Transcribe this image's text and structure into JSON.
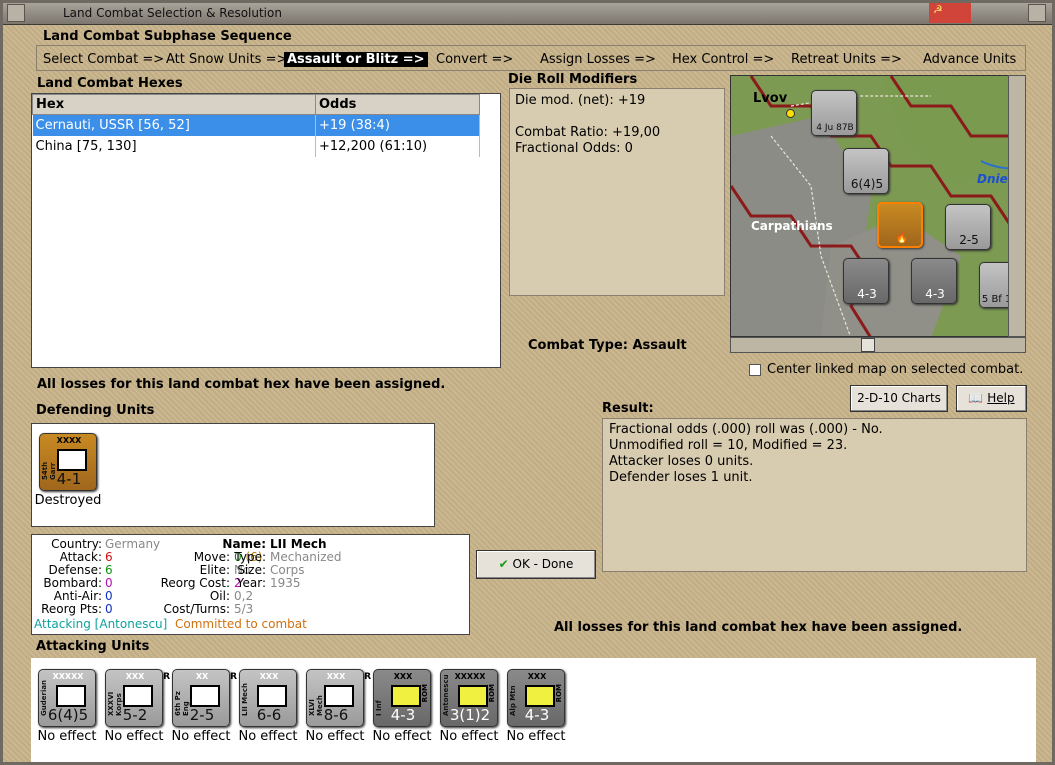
{
  "window": {
    "title": "Land Combat Selection & Resolution"
  },
  "subphase": {
    "heading": "Land Combat Subphase Sequence",
    "steps": [
      "Select Combat =>",
      "Att Snow Units =>",
      "Assault or Blitz =>",
      "Convert =>",
      "Assign Losses =>",
      "Hex Control =>",
      "Retreat Units =>",
      "Advance Units"
    ],
    "active_index": 2
  },
  "hexes": {
    "heading": "Land Combat Hexes",
    "columns": [
      "Hex",
      "Odds"
    ],
    "rows": [
      {
        "hex": "Cernauti, USSR [56, 52]",
        "odds": "+19 (38:4)"
      },
      {
        "hex": "China [75, 130]",
        "odds": "+12,200 (61:10)"
      }
    ],
    "selected_index": 0
  },
  "die_roll": {
    "heading": "Die Roll Modifiers",
    "net": "Die mod. (net): +19",
    "ratio": "Combat Ratio: +19,00",
    "fractional": "Fractional Odds: 0"
  },
  "combat_type": {
    "label": "Combat Type:",
    "value": "Assault"
  },
  "map": {
    "labels": {
      "city": "Lvov",
      "region": "Carpathians",
      "river": "Dnies"
    },
    "center_checkbox": {
      "label": "Center linked map on selected combat.",
      "checked": false
    }
  },
  "losses_msg": "All losses for this land combat hex have been assigned.",
  "defending": {
    "heading": "Defending Units",
    "units": [
      {
        "name": "54th Garr",
        "size": "XXXX",
        "value": "4-1",
        "status": "Destroyed",
        "color": "#b07822"
      }
    ]
  },
  "buttons": {
    "charts": "2-D-10 Charts",
    "help": "Help",
    "ok": "OK - Done"
  },
  "result": {
    "heading": "Result:",
    "lines": [
      "Fractional odds (.000) roll was (.000)  - No.",
      "Unmodified roll = 10, Modified = 23.",
      "Attacker loses 0 units.",
      "Defender loses 1 unit."
    ]
  },
  "unit_info": {
    "country_label": "Country:",
    "country": "Germany",
    "attack_label": "Attack:",
    "attack": "6",
    "defense_label": "Defense:",
    "defense": "6",
    "bombard_label": "Bombard:",
    "bombard": "0",
    "antiair_label": "Anti-Air:",
    "antiair": "0",
    "reorg_pts_label": "Reorg Pts:",
    "reorg_pts": "0",
    "name_label": "Name:",
    "name": "LII Mech",
    "move_label": "Move:",
    "move": "0",
    "move_paren": "(6)",
    "elite_label": "Elite:",
    "elite": "No",
    "reorg_cost_label": "Reorg Cost:",
    "reorg_cost": "2",
    "oil_label": "Oil:",
    "oil": "0,2",
    "cost_label": "Cost/Turns:",
    "cost": "5/3",
    "type_label": "Type:",
    "type": "Mechanized",
    "size_label": "Size:",
    "size": "Corps",
    "year_label": "Year:",
    "year": "1935",
    "attacking": "Attacking [Antonescu]",
    "committed": "Committed to combat"
  },
  "losses_msg2": "All losses for this land combat hex have been assigned.",
  "attacking": {
    "heading": "Attacking Units",
    "units": [
      {
        "name": "Guderian",
        "size": "XXXXX",
        "value": "6(4)5",
        "status": "No effect",
        "style": "grey"
      },
      {
        "name": "XXXVI Korps",
        "size": "XXX",
        "value": "5-2",
        "status": "No effect",
        "style": "grey",
        "flag": "R"
      },
      {
        "name": "6th Pz Eng",
        "size": "XX",
        "value": "2-5",
        "status": "No effect",
        "style": "grey",
        "flag": "R"
      },
      {
        "name": "LII Mech",
        "size": "XXX",
        "value": "6-6",
        "status": "No effect",
        "style": "grey"
      },
      {
        "name": "XLVI Mech",
        "size": "XXX",
        "value": "8-6",
        "status": "No effect",
        "style": "grey",
        "flag": "R"
      },
      {
        "name": "I Inf",
        "size": "XXX",
        "value": "4-3",
        "status": "No effect",
        "style": "dark",
        "nation": "ROM"
      },
      {
        "name": "Antonescu",
        "size": "XXXXX",
        "value": "3(1)2",
        "status": "No effect",
        "style": "dark",
        "nation": "ROM"
      },
      {
        "name": "Alp Mtn",
        "size": "XXX",
        "value": "4-3",
        "status": "No effect",
        "style": "dark",
        "nation": "ROM"
      }
    ]
  }
}
